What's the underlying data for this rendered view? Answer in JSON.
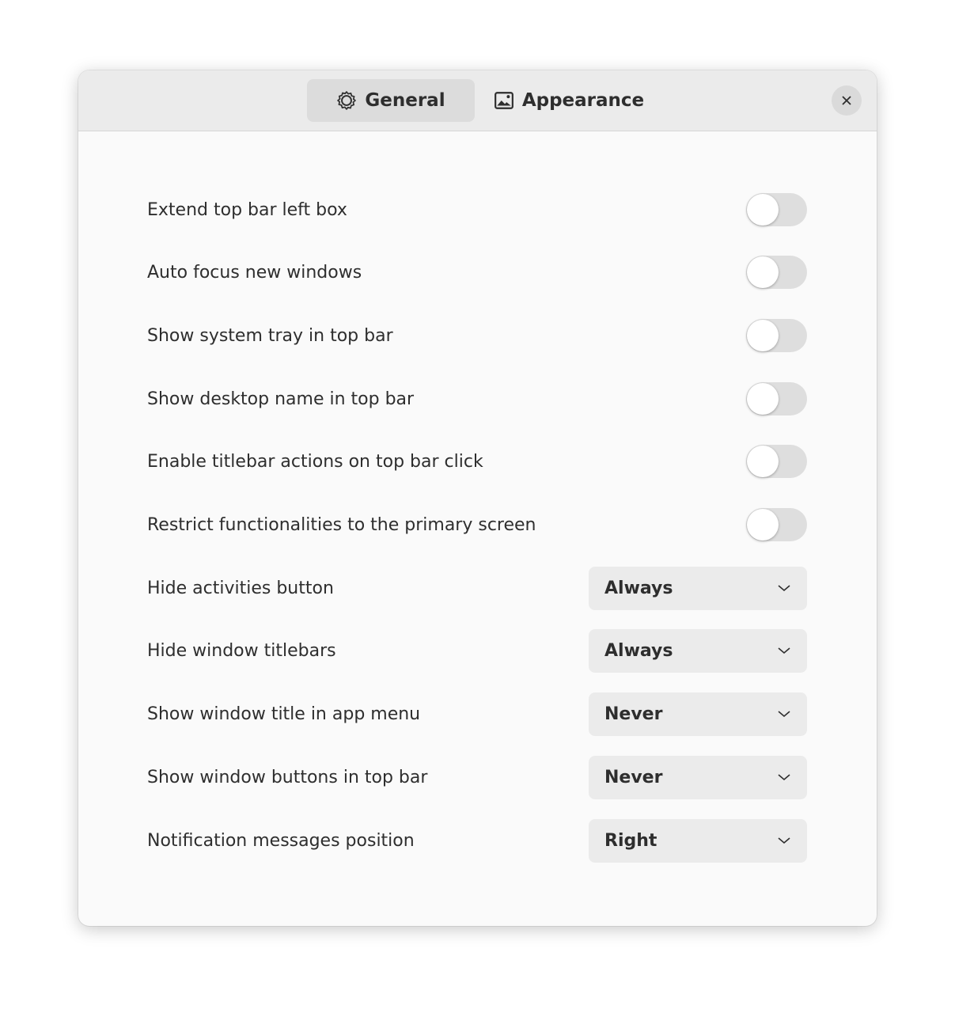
{
  "tabs": [
    {
      "label": "General",
      "icon": "gear-icon",
      "active": true
    },
    {
      "label": "Appearance",
      "icon": "image-icon",
      "active": false
    }
  ],
  "close_icon": "close-icon",
  "toggles": [
    {
      "label": "Extend top bar left box",
      "on": false
    },
    {
      "label": "Auto focus new windows",
      "on": false
    },
    {
      "label": "Show system tray in top bar",
      "on": false
    },
    {
      "label": "Show desktop name in top bar",
      "on": false
    },
    {
      "label": "Enable titlebar actions on top bar click",
      "on": false
    },
    {
      "label": "Restrict functionalities to the primary screen",
      "on": false
    }
  ],
  "dropdowns": [
    {
      "label": "Hide activities button",
      "value": "Always"
    },
    {
      "label": "Hide window titlebars",
      "value": "Always"
    },
    {
      "label": "Show window title in app menu",
      "value": "Never"
    },
    {
      "label": "Show window buttons in top bar",
      "value": "Never"
    },
    {
      "label": "Notification messages position",
      "value": "Right"
    }
  ]
}
